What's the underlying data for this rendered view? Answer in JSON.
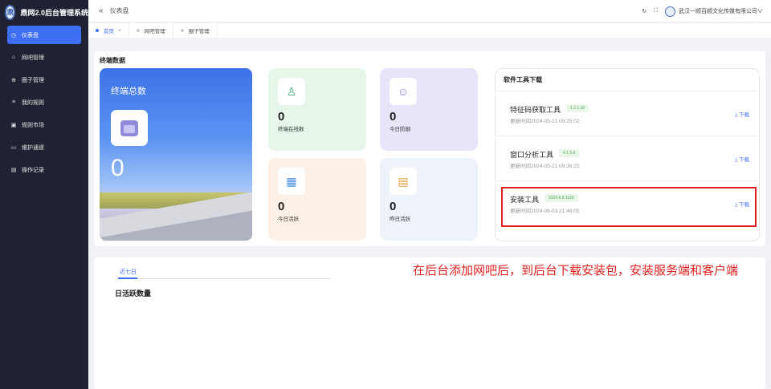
{
  "app": {
    "title": "鼎网2.0后台管理系统",
    "logo_text": "鼎"
  },
  "sidebar": {
    "items": [
      {
        "label": "仪表盘",
        "icon": "dashboard-icon",
        "glyph": "◷"
      },
      {
        "label": "网吧管理",
        "icon": "home-icon",
        "glyph": "⌂"
      },
      {
        "label": "圈子管理",
        "icon": "plus-circle-icon",
        "glyph": "⊕"
      },
      {
        "label": "我的规则",
        "icon": "list-icon",
        "glyph": "≡"
      },
      {
        "label": "规则市场",
        "icon": "shop-icon",
        "glyph": "▣"
      },
      {
        "label": "维护通道",
        "icon": "monitor-icon",
        "glyph": "▭"
      },
      {
        "label": "操作记录",
        "icon": "document-icon",
        "glyph": "▤"
      }
    ]
  },
  "header": {
    "collapse_glyph": "«",
    "breadcrumb": "仪表盘",
    "refresh_glyph": "↻",
    "fullscreen_glyph": "⛶",
    "company": "武汉一顺百顺文化传媒有限公司∨"
  },
  "tabs": [
    {
      "label": "首页",
      "close": "×"
    },
    {
      "label": "网吧管理"
    },
    {
      "label": "圈子管理"
    }
  ],
  "terminal": {
    "section_title": "终端数据",
    "total_label": "终端总数",
    "total_value": "0",
    "stats": [
      {
        "value": "0",
        "label": "终端在线数",
        "icon": "user-icon",
        "glyph": "♙",
        "bg": "#e6f6e9",
        "color": "#3eb277"
      },
      {
        "value": "0",
        "label": "今日防御",
        "icon": "group-icon",
        "glyph": "☺",
        "bg": "#e8e4fa",
        "color": "#8c7fe0"
      },
      {
        "value": "0",
        "label": "今日活跃",
        "icon": "calendar-icon",
        "glyph": "▦",
        "bg": "#fdf0e6",
        "color": "#4a90e2"
      },
      {
        "value": "0",
        "label": "昨日活跃",
        "icon": "calendar-clock-icon",
        "glyph": "▤",
        "bg": "#eef2fb",
        "color": "#e8a035"
      }
    ]
  },
  "software": {
    "title": "软件工具下载",
    "items": [
      {
        "name": "特征码获取工具",
        "version": "1.2.1.16",
        "date": "更新时间2024-05-21 09:25:02",
        "download": "⤓ 下载"
      },
      {
        "name": "窗口分析工具",
        "version": "4.1.5.0",
        "date": "更新时间2024-05-21 09:36:25",
        "download": "⤓ 下载"
      },
      {
        "name": "安装工具",
        "version": "2024.6.3.1120",
        "date": "更新时间2024-06-03 21:46:05",
        "download": "⤓ 下载"
      }
    ]
  },
  "activity": {
    "range_tab": "近七日",
    "title": "日活跃数量"
  },
  "annotation": "在后台添加网吧后，到后台下载安装包，安装服务端和客户端"
}
